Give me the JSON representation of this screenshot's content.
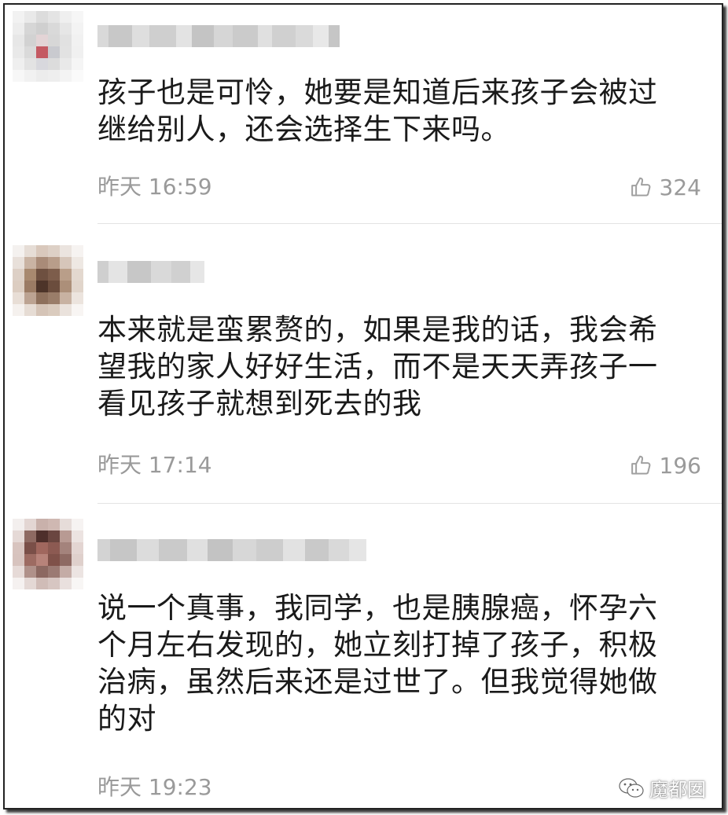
{
  "comments": [
    {
      "text_lines": [
        "孩子也是可怜，她要是知道后来孩子会被过",
        "继给别人，还会选择生下来吗。"
      ],
      "day": "昨天",
      "time": "16:59",
      "likes": "324",
      "like_icon": "thumbs-up-icon"
    },
    {
      "text_lines": [
        "本来就是蛮累赘的，如果是我的话，我会希",
        "望我的家人好好生活，而不是天天弄孩子一",
        "看见孩子就想到死去的我"
      ],
      "day": "昨天",
      "time": "17:14",
      "likes": "196",
      "like_icon": "thumbs-up-icon"
    },
    {
      "text_lines": [
        "说一个真事，我同学，也是胰腺癌，怀孕六",
        "个月左右发现的，她立刻打掉了孩子，积极",
        "治病，虽然后来还是过世了。但我觉得她做",
        "的对"
      ],
      "day": "昨天",
      "time": "19:23",
      "likes": "",
      "like_icon": "thumbs-up-icon"
    }
  ],
  "watermark": {
    "label": "魔都囡",
    "icon": "wechat-icon"
  }
}
